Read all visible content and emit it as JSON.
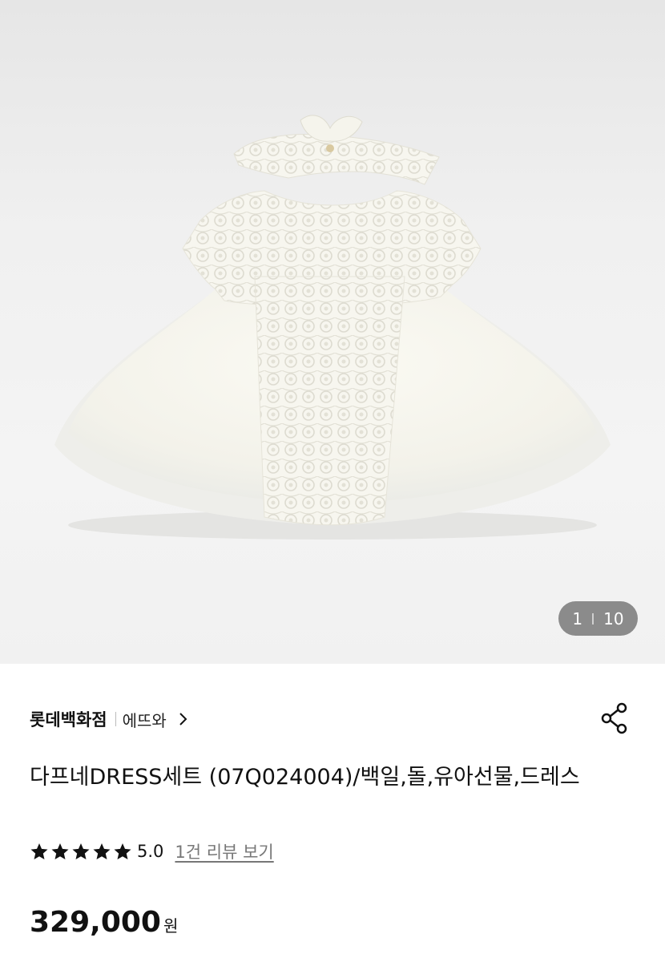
{
  "gallery": {
    "image_icon": "white-lace-baby-dress-with-headband",
    "current": "1",
    "total": "10"
  },
  "store": {
    "name": "롯데백화점",
    "brand": "에뜨와",
    "chevron_icon": "chevron-right-icon",
    "share_icon": "share-icon"
  },
  "product": {
    "title": "다프네DRESS세트 (07Q024004)/백일,돌,유아선물,드레스",
    "rating": {
      "stars": 5,
      "score": "5.0",
      "review_link": "1건 리뷰 보기"
    },
    "price": "329,000",
    "currency": "원"
  },
  "colors": {
    "counter_bg": "#6e6e6e",
    "text": "#111111",
    "link": "#777777"
  }
}
